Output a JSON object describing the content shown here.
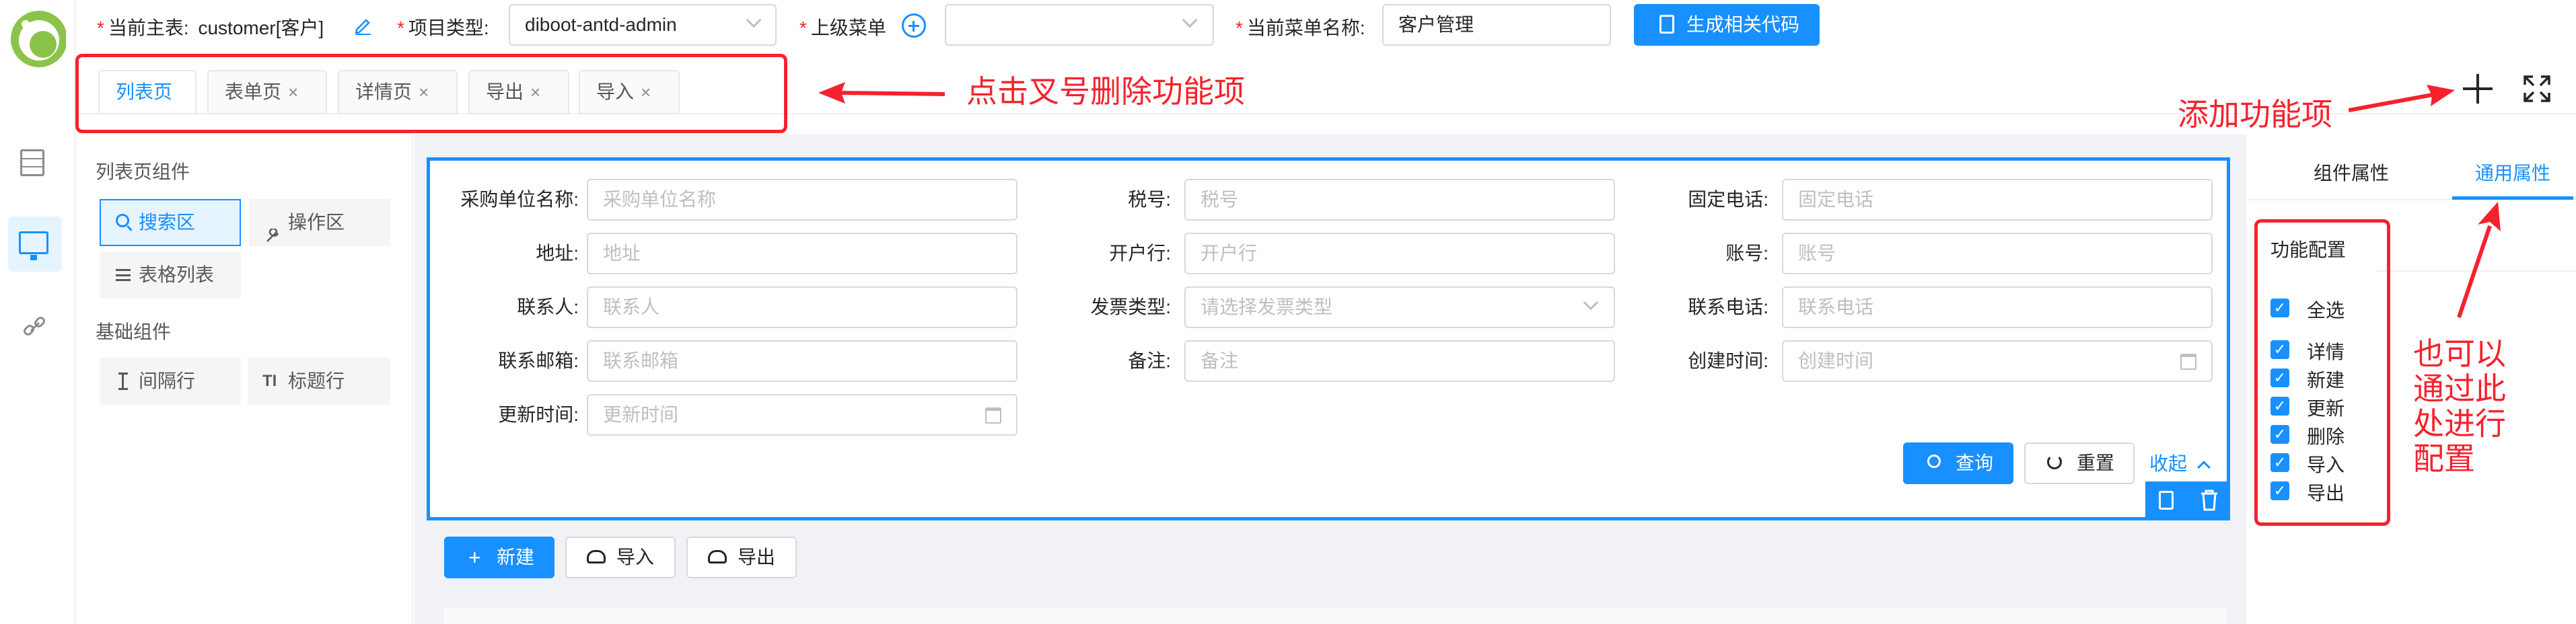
{
  "topbar": {
    "main_table_label": "当前主表:",
    "main_table_value": "customer[客户]",
    "project_type_label": "项目类型:",
    "project_type_value": "diboot-antd-admin",
    "parent_menu_label": "上级菜单",
    "current_menu_label": "当前菜单名称:",
    "current_menu_value": "客户管理",
    "generate_label": "生成相关代码"
  },
  "tabs": [
    {
      "label": "列表页",
      "closable": false
    },
    {
      "label": "表单页",
      "closable": true
    },
    {
      "label": "详情页",
      "closable": true
    },
    {
      "label": "导出",
      "closable": true
    },
    {
      "label": "导入",
      "closable": true
    }
  ],
  "close_glyph": "×",
  "annotations": {
    "delete_hint": "点击叉号删除功能项",
    "add_hint": "添加功能项",
    "config_hint_lines": [
      "也可以",
      "通过此",
      "处进行",
      "配置"
    ]
  },
  "left_panel": {
    "list_components_title": "列表页组件",
    "search_area": "搜索区",
    "action_area": "操作区",
    "table_list": "表格列表",
    "basic_components_title": "基础组件",
    "spacer_row": "间隔行",
    "title_row": "标题行"
  },
  "search_form": {
    "fields": [
      {
        "label": "采购单位名称:",
        "placeholder": "采购单位名称"
      },
      {
        "label": "税号:",
        "placeholder": "税号"
      },
      {
        "label": "固定电话:",
        "placeholder": "固定电话"
      },
      {
        "label": "地址:",
        "placeholder": "地址"
      },
      {
        "label": "开户行:",
        "placeholder": "开户行"
      },
      {
        "label": "账号:",
        "placeholder": "账号"
      },
      {
        "label": "联系人:",
        "placeholder": "联系人"
      },
      {
        "label": "发票类型:",
        "placeholder": "请选择发票类型"
      },
      {
        "label": "联系电话:",
        "placeholder": "联系电话"
      },
      {
        "label": "联系邮箱:",
        "placeholder": "联系邮箱"
      },
      {
        "label": "备注:",
        "placeholder": "备注"
      },
      {
        "label": "创建时间:",
        "placeholder": "创建时间"
      },
      {
        "label": "更新时间:",
        "placeholder": "更新时间"
      }
    ],
    "query_label": "查询",
    "reset_label": "重置",
    "collapse_label": "收起"
  },
  "actions": {
    "new_label": "新建",
    "import_label": "导入",
    "export_label": "导出"
  },
  "right_panel": {
    "tab_component_props": "组件属性",
    "tab_common_props": "通用属性",
    "function_config_title": "功能配置",
    "select_all": "全选",
    "options": [
      "详情",
      "新建",
      "更新",
      "删除",
      "导入",
      "导出"
    ]
  },
  "colors": {
    "primary": "#1890ff",
    "annotation_red": "#f5222d",
    "logo_green": "#8bc34a"
  }
}
